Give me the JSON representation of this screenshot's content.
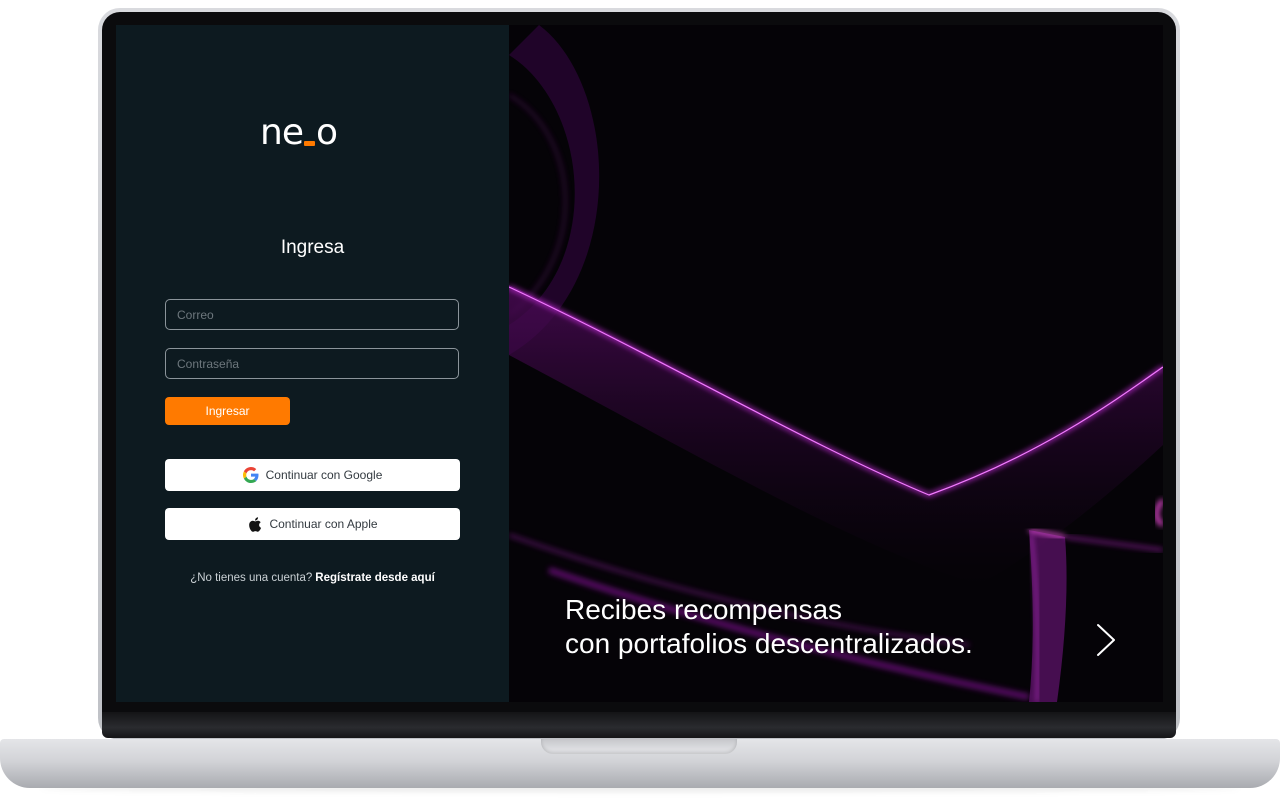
{
  "brand": {
    "logo_left": "ne",
    "logo_right": "o",
    "accent_color": "#ff7a00"
  },
  "login": {
    "heading": "Ingresa",
    "email_placeholder": "Correo",
    "password_placeholder": "Contraseña",
    "submit_label": "Ingresar",
    "google_label": "Continuar con Google",
    "apple_label": "Continuar con Apple",
    "signup_prompt": "¿No tienes una cuenta?",
    "signup_link": "Regístrate desde aquí"
  },
  "hero": {
    "line1": "Recibes recompensas",
    "line2": "con portafolios descentralizados.",
    "next_icon": "chevron-right-icon"
  },
  "colors": {
    "panel_bg": "#0d1a20",
    "hero_glow": "#c41bd6"
  }
}
